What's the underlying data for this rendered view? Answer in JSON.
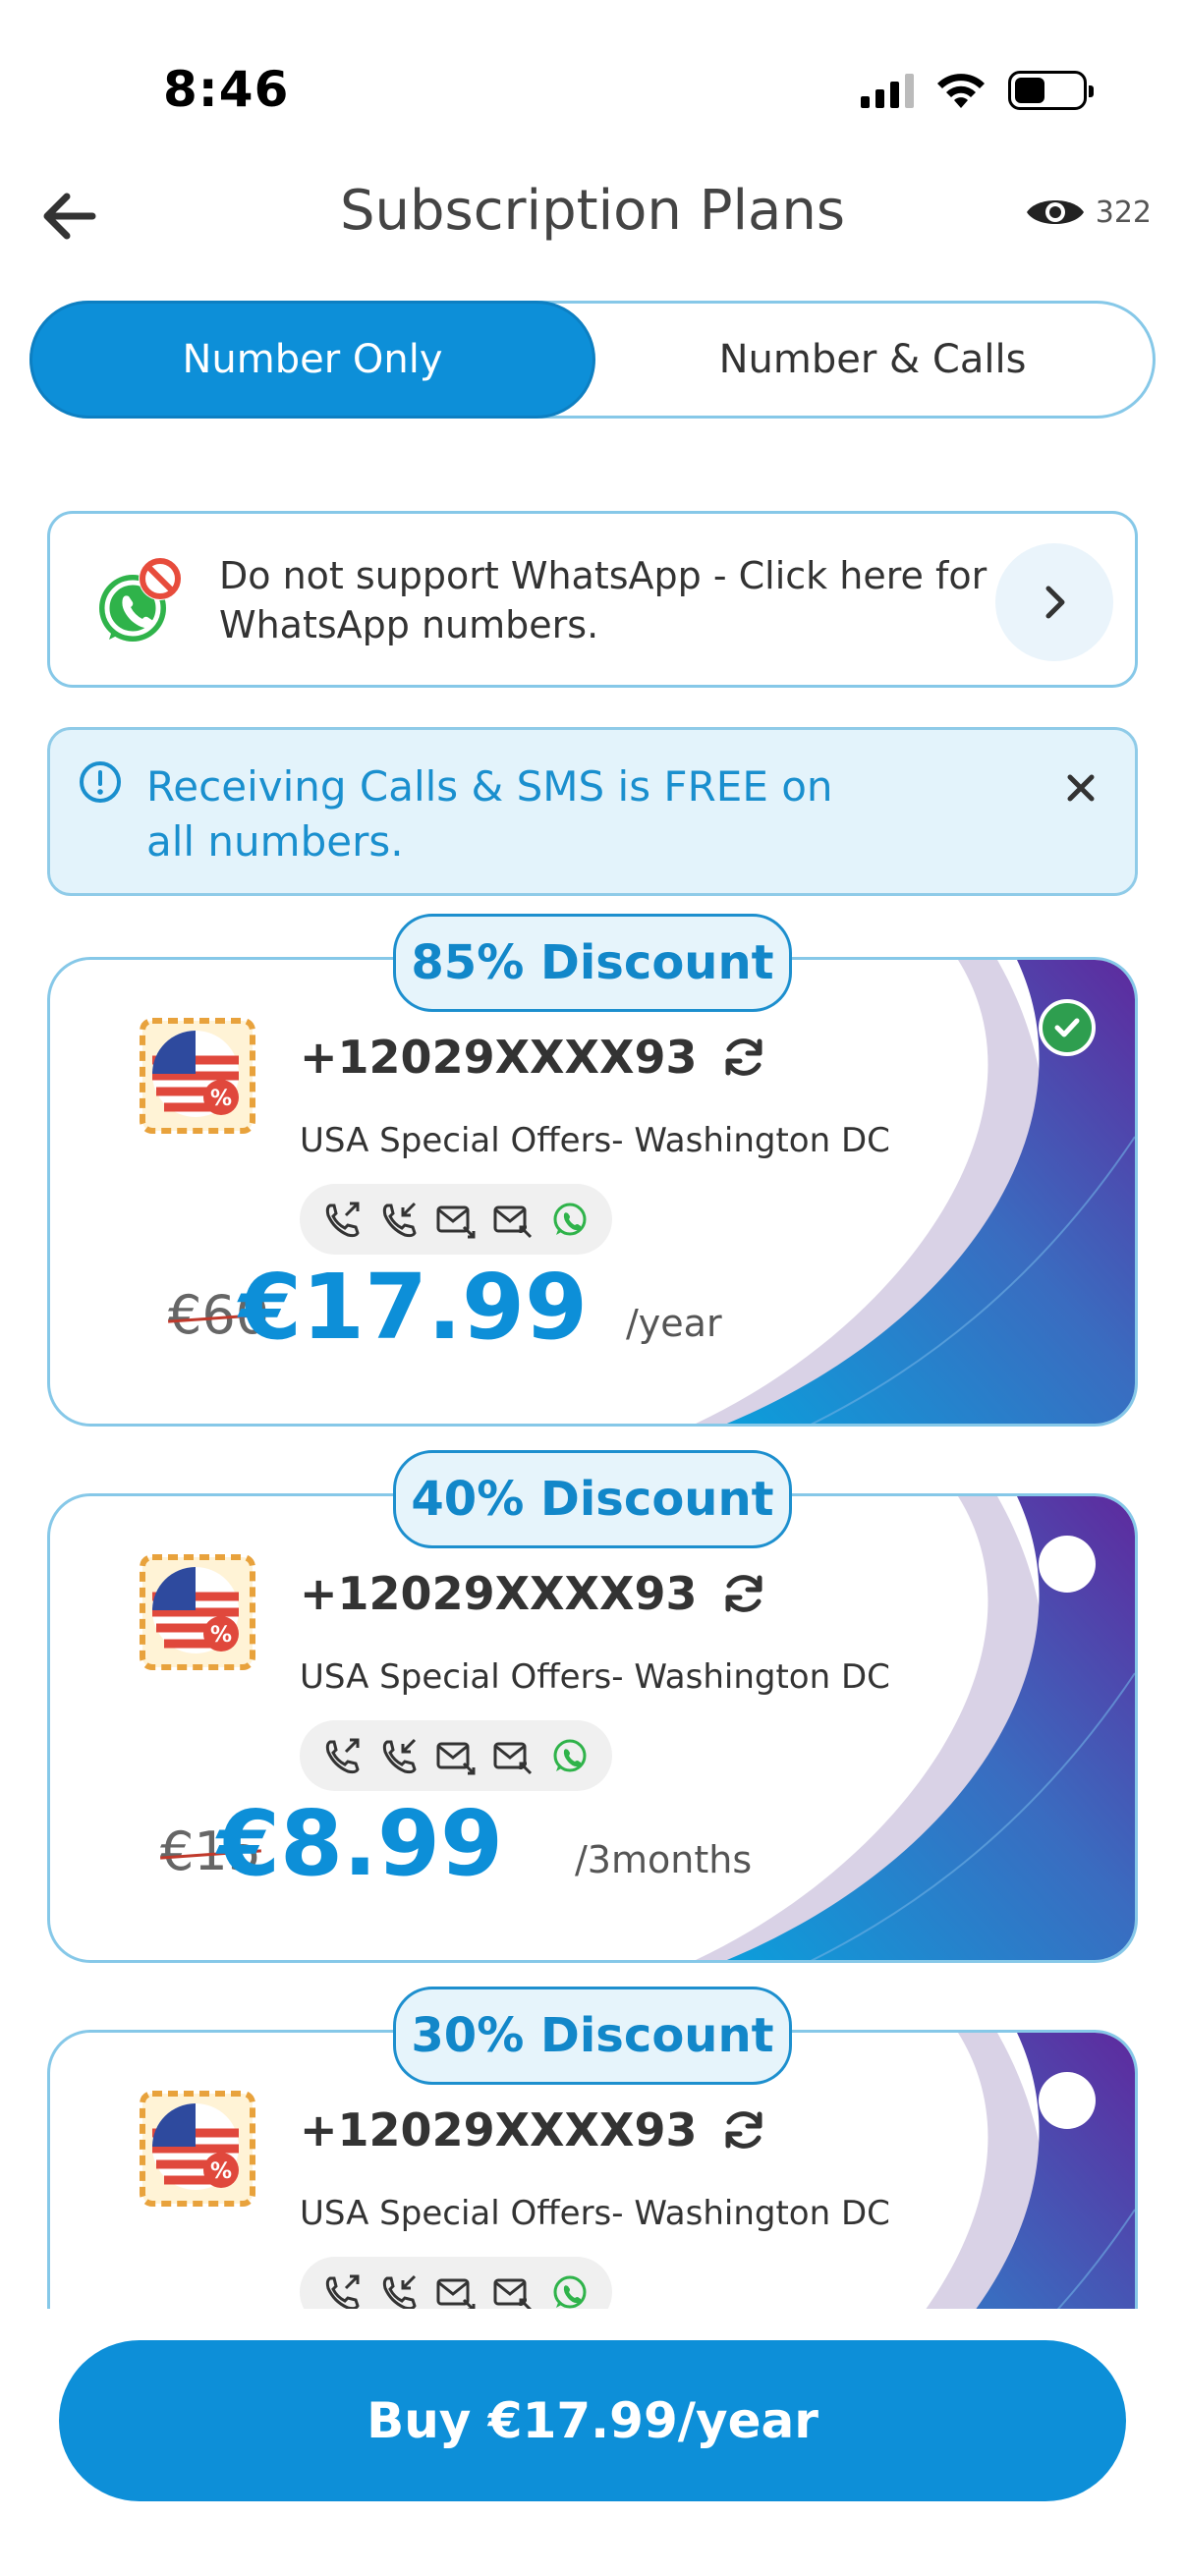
{
  "status": {
    "time": "8:46"
  },
  "header": {
    "title": "Subscription Plans",
    "views": "322"
  },
  "tabs": [
    {
      "label": "Number Only",
      "active": true
    },
    {
      "label": "Number & Calls",
      "active": false
    }
  ],
  "whatsapp_notice": {
    "text": "Do not support WhatsApp - Click here for WhatsApp numbers."
  },
  "info_banner": {
    "text": "Receiving Calls & SMS is FREE on all numbers."
  },
  "plans": [
    {
      "discount": "85% Discount",
      "number": "+12029XXXX93",
      "location": "USA Special Offers- Washington DC",
      "old_price": "€60",
      "price": "€17.99",
      "period": "/year",
      "selected": true
    },
    {
      "discount": "40% Discount",
      "number": "+12029XXXX93",
      "location": "USA Special Offers- Washington DC",
      "old_price": "€15",
      "price": "€8.99",
      "period": "/3months",
      "selected": false
    },
    {
      "discount": "30% Discount",
      "number": "+12029XXXX93",
      "location": "USA Special Offers- Washington DC",
      "old_price": "",
      "price": "",
      "period": "",
      "selected": false
    }
  ],
  "buy_button": {
    "label": "Buy €17.99/year"
  },
  "colors": {
    "accent": "#0d8fd8",
    "border": "#86c8e8",
    "info_bg": "#e3f3fb",
    "check": "#2e9e4f",
    "deco_purple": "#5a2a9c"
  },
  "icons": [
    "back-arrow-icon",
    "eye-icon",
    "whatsapp-blocked-icon",
    "chevron-right-icon",
    "info-icon",
    "close-icon",
    "refresh-icon",
    "outgoing-call-icon",
    "incoming-call-icon",
    "outgoing-sms-icon",
    "incoming-sms-icon",
    "whatsapp-icon",
    "check-icon",
    "usa-discount-badge-icon"
  ]
}
